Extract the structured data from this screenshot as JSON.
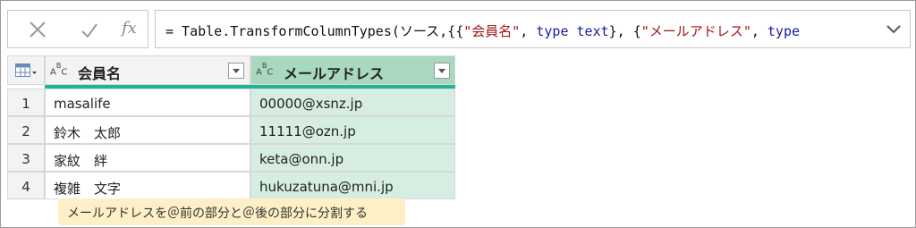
{
  "formula_bar": {
    "fx_label": "fx",
    "icons": [
      "cancel-icon",
      "check-icon",
      "chevron-down-icon"
    ],
    "formula_parts": [
      {
        "text": "= Table.TransformColumnTypes(ソース,{{",
        "kind": "plain"
      },
      {
        "text": "\"会員名\"",
        "kind": "str"
      },
      {
        "text": ", ",
        "kind": "plain"
      },
      {
        "text": "type text",
        "kind": "kw"
      },
      {
        "text": "}, {",
        "kind": "plain"
      },
      {
        "text": "\"メールアドレス\"",
        "kind": "str"
      },
      {
        "text": ", ",
        "kind": "plain"
      },
      {
        "text": "type",
        "kind": "kw"
      }
    ]
  },
  "table": {
    "columns": [
      {
        "name": "会員名",
        "type_icon": "text-type-icon",
        "type_label": "ABC"
      },
      {
        "name": "メールアドレス",
        "type_icon": "text-type-icon",
        "type_label": "ABC"
      }
    ],
    "rows": [
      {
        "num": "1",
        "name": "masalife",
        "email": "00000@xsnz.jp"
      },
      {
        "num": "2",
        "name": "鈴木　太郎",
        "email": "11111@ozn.jp"
      },
      {
        "num": "3",
        "name": "家紋　絆",
        "email": "keta@onn.jp"
      },
      {
        "num": "4",
        "name": "複雑　文字",
        "email": "hukuzatuna@mni.jp"
      }
    ],
    "selected_column": "メールアドレス",
    "colors": {
      "accent_bar": "#1eb596",
      "selected_header": "#a8d8bd",
      "selected_cells": "#d6eee2"
    }
  },
  "callout": {
    "text": "メールアドレスを＠前の部分と＠後の部分に分割する"
  }
}
